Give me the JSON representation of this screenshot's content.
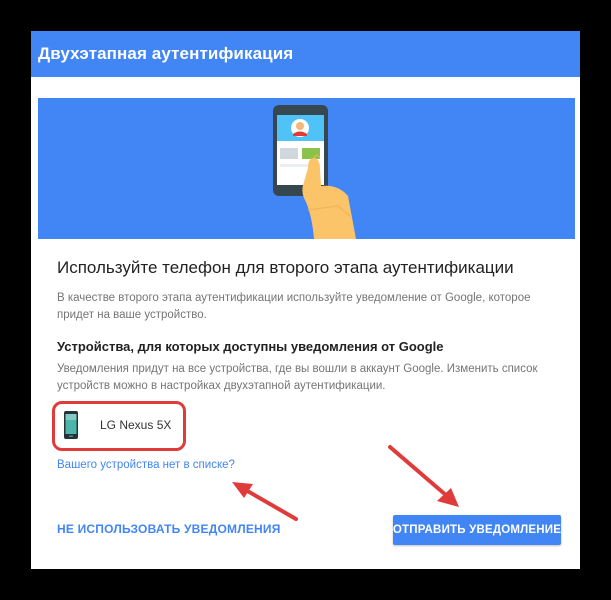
{
  "header": {
    "title": "Двухэтапная аутентификация"
  },
  "main": {
    "heading": "Используйте телефон для второго этапа аутентификации",
    "description": "В качестве второго этапа аутентификации используйте уведомление от Google, которое придет на ваше устройство.",
    "devices_heading": "Устройства, для которых доступны уведомления от Google",
    "devices_description": "Уведомления придут на все устройства, где вы вошли в аккаунт Google. Изменить список устройств можно в настройках двухэтапной аутентификации.",
    "device": {
      "name": "LG Nexus 5X"
    },
    "not_listed_link": "Вашего устройства нет в списке?"
  },
  "actions": {
    "secondary_label": "НЕ ИСПОЛЬЗОВАТЬ УВЕДОМЛЕНИЯ",
    "primary_label": "ОТПРАВИТЬ УВЕДОМЛЕНИЕ"
  },
  "colors": {
    "brand_blue": "#4285f4",
    "highlight_red": "#e03b3b",
    "text_dark": "#222222",
    "text_muted": "#757575"
  },
  "icons": [
    "phone-illustration",
    "phone-icon",
    "annotation-arrow"
  ]
}
